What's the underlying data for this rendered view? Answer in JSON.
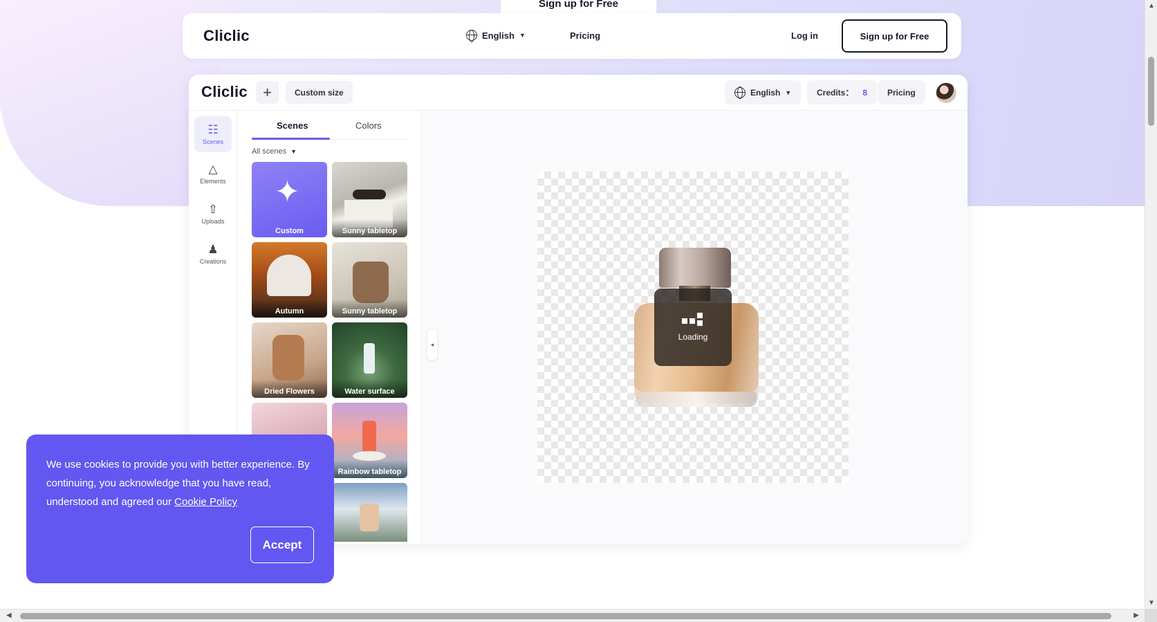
{
  "ghost_tab": {
    "label": "Sign up for Free"
  },
  "topnav": {
    "logo": "Cliclic",
    "language": "English",
    "pricing": "Pricing",
    "login": "Log in",
    "signup": "Sign up for Free"
  },
  "app": {
    "logo": "Cliclic",
    "plus": "+",
    "custom_size": "Custom size",
    "language": "English",
    "credits_label": "Credits：",
    "credits_value": "8",
    "pricing": "Pricing"
  },
  "rail": {
    "items": [
      {
        "label": "Scenes",
        "icon": "grid-icon",
        "glyph": "☷"
      },
      {
        "label": "Elements",
        "icon": "shapes-icon",
        "glyph": "△"
      },
      {
        "label": "Uploads",
        "icon": "upload-cloud-icon",
        "glyph": "⇧"
      },
      {
        "label": "Creations",
        "icon": "user-creations-icon",
        "glyph": "♟"
      }
    ]
  },
  "panel": {
    "tabs": [
      "Scenes",
      "Colors"
    ],
    "filter": "All scenes",
    "cards": [
      {
        "label": "Custom"
      },
      {
        "label": "Sunny tabletop"
      },
      {
        "label": "Autumn"
      },
      {
        "label": "Sunny tabletop"
      },
      {
        "label": "Dried Flowers"
      },
      {
        "label": "Water surface"
      },
      {
        "label": ""
      },
      {
        "label": "Rainbow tabletop"
      },
      {
        "label": ""
      },
      {
        "label": ""
      }
    ]
  },
  "canvas": {
    "loading": "Loading"
  },
  "cookie": {
    "message": "We use cookies to provide you with better experience. By continuing, you acknowledge that you have read, understood and agreed our ",
    "link": "Cookie Policy",
    "accept": "Accept"
  },
  "colors": {
    "accent": "#6c5ce7",
    "cookie_bg": "#6257f0"
  }
}
